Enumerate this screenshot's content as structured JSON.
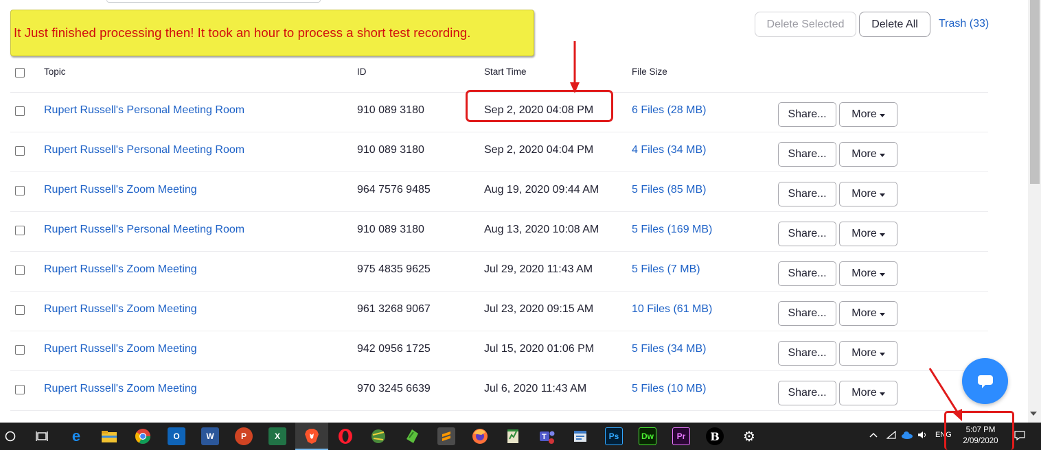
{
  "annotation": {
    "note": "It Just finished processing then!  It took an hour to process a short test recording."
  },
  "toolbar": {
    "delete_selected": "Delete Selected",
    "delete_all": "Delete All",
    "trash": "Trash (33)"
  },
  "table": {
    "headers": {
      "topic": "Topic",
      "id": "ID",
      "start": "Start Time",
      "size": "File Size"
    },
    "share_label": "Share...",
    "more_label": "More",
    "rows": [
      {
        "topic": "Rupert Russell's Personal Meeting Room",
        "id": "910 089 3180",
        "start": "Sep 2, 2020 04:08 PM",
        "files": "6 Files (28 MB)"
      },
      {
        "topic": "Rupert Russell's Personal Meeting Room",
        "id": "910 089 3180",
        "start": "Sep 2, 2020 04:04 PM",
        "files": "4 Files (34 MB)"
      },
      {
        "topic": "Rupert Russell's Zoom Meeting",
        "id": "964 7576 9485",
        "start": "Aug 19, 2020 09:44 AM",
        "files": "5 Files (85 MB)"
      },
      {
        "topic": "Rupert Russell's Personal Meeting Room",
        "id": "910 089 3180",
        "start": "Aug 13, 2020 10:08 AM",
        "files": "5 Files (169 MB)"
      },
      {
        "topic": "Rupert Russell's Zoom Meeting",
        "id": "975 4835 9625",
        "start": "Jul 29, 2020 11:43 AM",
        "files": "5 Files (7 MB)"
      },
      {
        "topic": "Rupert Russell's Zoom Meeting",
        "id": "961 3268 9067",
        "start": "Jul 23, 2020 09:15 AM",
        "files": "10 Files (61 MB)"
      },
      {
        "topic": "Rupert Russell's Zoom Meeting",
        "id": "942 0956 1725",
        "start": "Jul 15, 2020 01:06 PM",
        "files": "5 Files (34 MB)"
      },
      {
        "topic": "Rupert Russell's Zoom Meeting",
        "id": "970 3245 6639",
        "start": "Jul 6, 2020 11:43 AM",
        "files": "5 Files (10 MB)"
      }
    ]
  },
  "taskbar": {
    "apps": [
      "start-circle-icon",
      "task-view-icon",
      "edge-icon",
      "file-explorer-icon",
      "chrome-icon",
      "outlook-icon",
      "word-icon",
      "powerpoint-icon",
      "excel-icon",
      "brave-icon",
      "opera-icon",
      "globe-app-icon",
      "green-app-icon",
      "sublime-icon",
      "firefox-icon",
      "notepad-icon",
      "teams-icon",
      "app-icon",
      "photoshop-icon",
      "dreamweaver-icon",
      "premiere-icon",
      "b-app-icon",
      "settings-icon"
    ],
    "labels": {
      "ps": "Ps",
      "dw": "Dw",
      "pr": "Pr",
      "word": "W",
      "excel": "X",
      "outlook": "O",
      "ppt": "P",
      "b": "B"
    },
    "language": "ENG",
    "time": "5:07 PM",
    "date": "2/09/2020"
  },
  "colors": {
    "link": "#1e62c7",
    "annotation_red": "#e01b1b",
    "note_bg": "#f2ef44",
    "chat_blue": "#2d8cff",
    "taskbar_bg": "#1f1f1f"
  }
}
